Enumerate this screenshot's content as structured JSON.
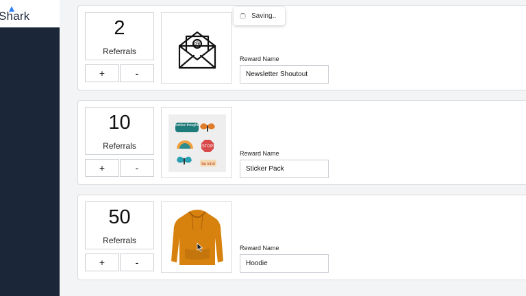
{
  "brand": {
    "name": "Shark"
  },
  "toast": {
    "text": "Saving.."
  },
  "cards": [
    {
      "count": "2",
      "count_label": "Referrals",
      "plus": "+",
      "minus": "-",
      "reward_label": "Reward Name",
      "reward_value": "Newsletter Shoutout",
      "image": "envelope-icon"
    },
    {
      "count": "10",
      "count_label": "Referrals",
      "plus": "+",
      "minus": "-",
      "reward_label": "Reward Name",
      "reward_value": "Sticker Pack",
      "image": "sticker-pack-image",
      "stickers": [
        "positive thoughts",
        "STOP",
        "be kind"
      ]
    },
    {
      "count": "50",
      "count_label": "Referrals",
      "plus": "+",
      "minus": "-",
      "reward_label": "Reward Name",
      "reward_value": "Hoodie",
      "image": "hoodie-image"
    }
  ],
  "colors": {
    "sidebar": "#1b2638",
    "accent": "#2d7ff9",
    "hoodie": "#d7820f"
  }
}
